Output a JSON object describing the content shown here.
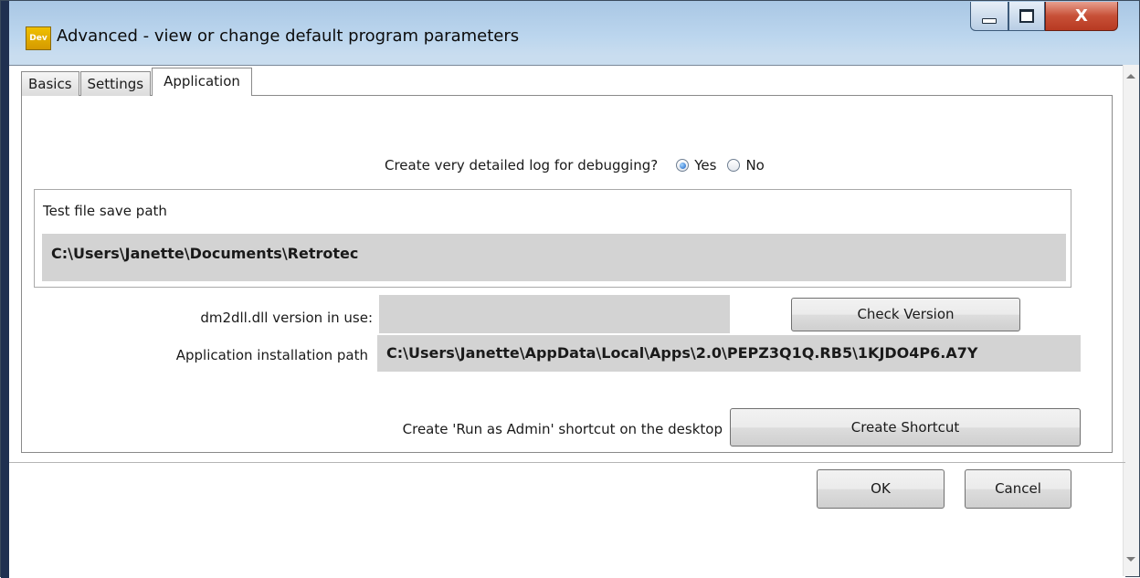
{
  "window": {
    "title": "Advanced - view or change default program parameters",
    "icon_text": "Dev",
    "close_glyph": "X"
  },
  "tabs": [
    {
      "label": "Basics",
      "active": false
    },
    {
      "label": "Settings",
      "active": false
    },
    {
      "label": "Application",
      "active": true
    }
  ],
  "debug": {
    "question": "Create very detailed log for debugging?",
    "options": [
      {
        "label": "Yes",
        "checked": true
      },
      {
        "label": "No",
        "checked": false
      }
    ]
  },
  "test_path": {
    "label": "Test file save path",
    "value": "C:\\Users\\Janette\\Documents\\Retrotec"
  },
  "dll": {
    "label": "dm2dll.dll version in use:",
    "value": "",
    "button": "Check Version"
  },
  "install": {
    "label": "Application installation path",
    "value": "C:\\Users\\Janette\\AppData\\Local\\Apps\\2.0\\PEPZ3Q1Q.RB5\\1KJDO4P6.A7Y"
  },
  "shortcut": {
    "label": "Create 'Run as Admin' shortcut on the desktop",
    "button": "Create Shortcut"
  },
  "footer": {
    "ok": "OK",
    "cancel": "Cancel"
  },
  "colors": {
    "titlebar": "#bcd6ee",
    "close": "#c75037",
    "field": "#d3d3d3",
    "radio_selected": "#1760c4"
  }
}
